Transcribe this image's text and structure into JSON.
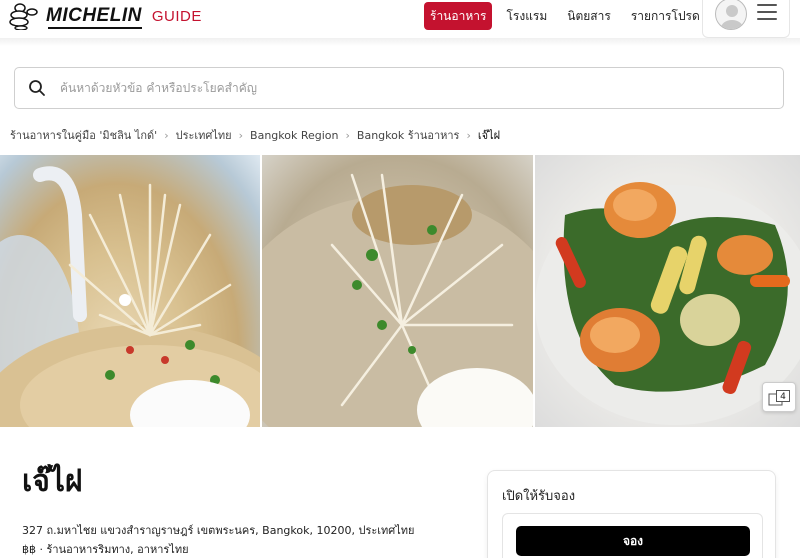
{
  "header": {
    "brand": "MICHELIN",
    "guide": "GUIDE",
    "nav": [
      {
        "label": "ร้านอาหาร",
        "active": true
      },
      {
        "label": "โรงแรม",
        "active": false
      },
      {
        "label": "นิตยสาร",
        "active": false
      },
      {
        "label": "รายการโปรด",
        "active": false
      }
    ],
    "icons": {
      "avatar": "user-avatar-icon",
      "menu": "hamburger-menu-icon"
    },
    "accent_color": "#c4122f"
  },
  "search": {
    "placeholder": "ค้นหาด้วยหัวข้อ คำหรือประโยคสำคัญ",
    "value": "",
    "icon": "search-icon"
  },
  "breadcrumb": [
    "ร้านอาหารในคู่มือ 'มิชลิน ไกด์'",
    "ประเทศไทย",
    "Bangkok Region",
    "Bangkok ร้านอาหาร",
    "เจ๊ไฝ"
  ],
  "gallery": {
    "photos": [
      "rice-porridge-with-ginger",
      "congee-with-egg-and-ginger",
      "stir-fried-prawns-with-vegetables"
    ],
    "photo_count": "4"
  },
  "restaurant": {
    "name": "เจ๊ไฝ",
    "address": "327 ถ.มหาไชย แขวงสำราญราษฎร์ เขตพระนคร, Bangkok, 10200, ประเทศไทย",
    "meta": "฿฿ · ร้านอาหารริมทาง, อาหารไทย"
  },
  "booking": {
    "title": "เปิดให้รับจอง",
    "button": "จอง"
  }
}
